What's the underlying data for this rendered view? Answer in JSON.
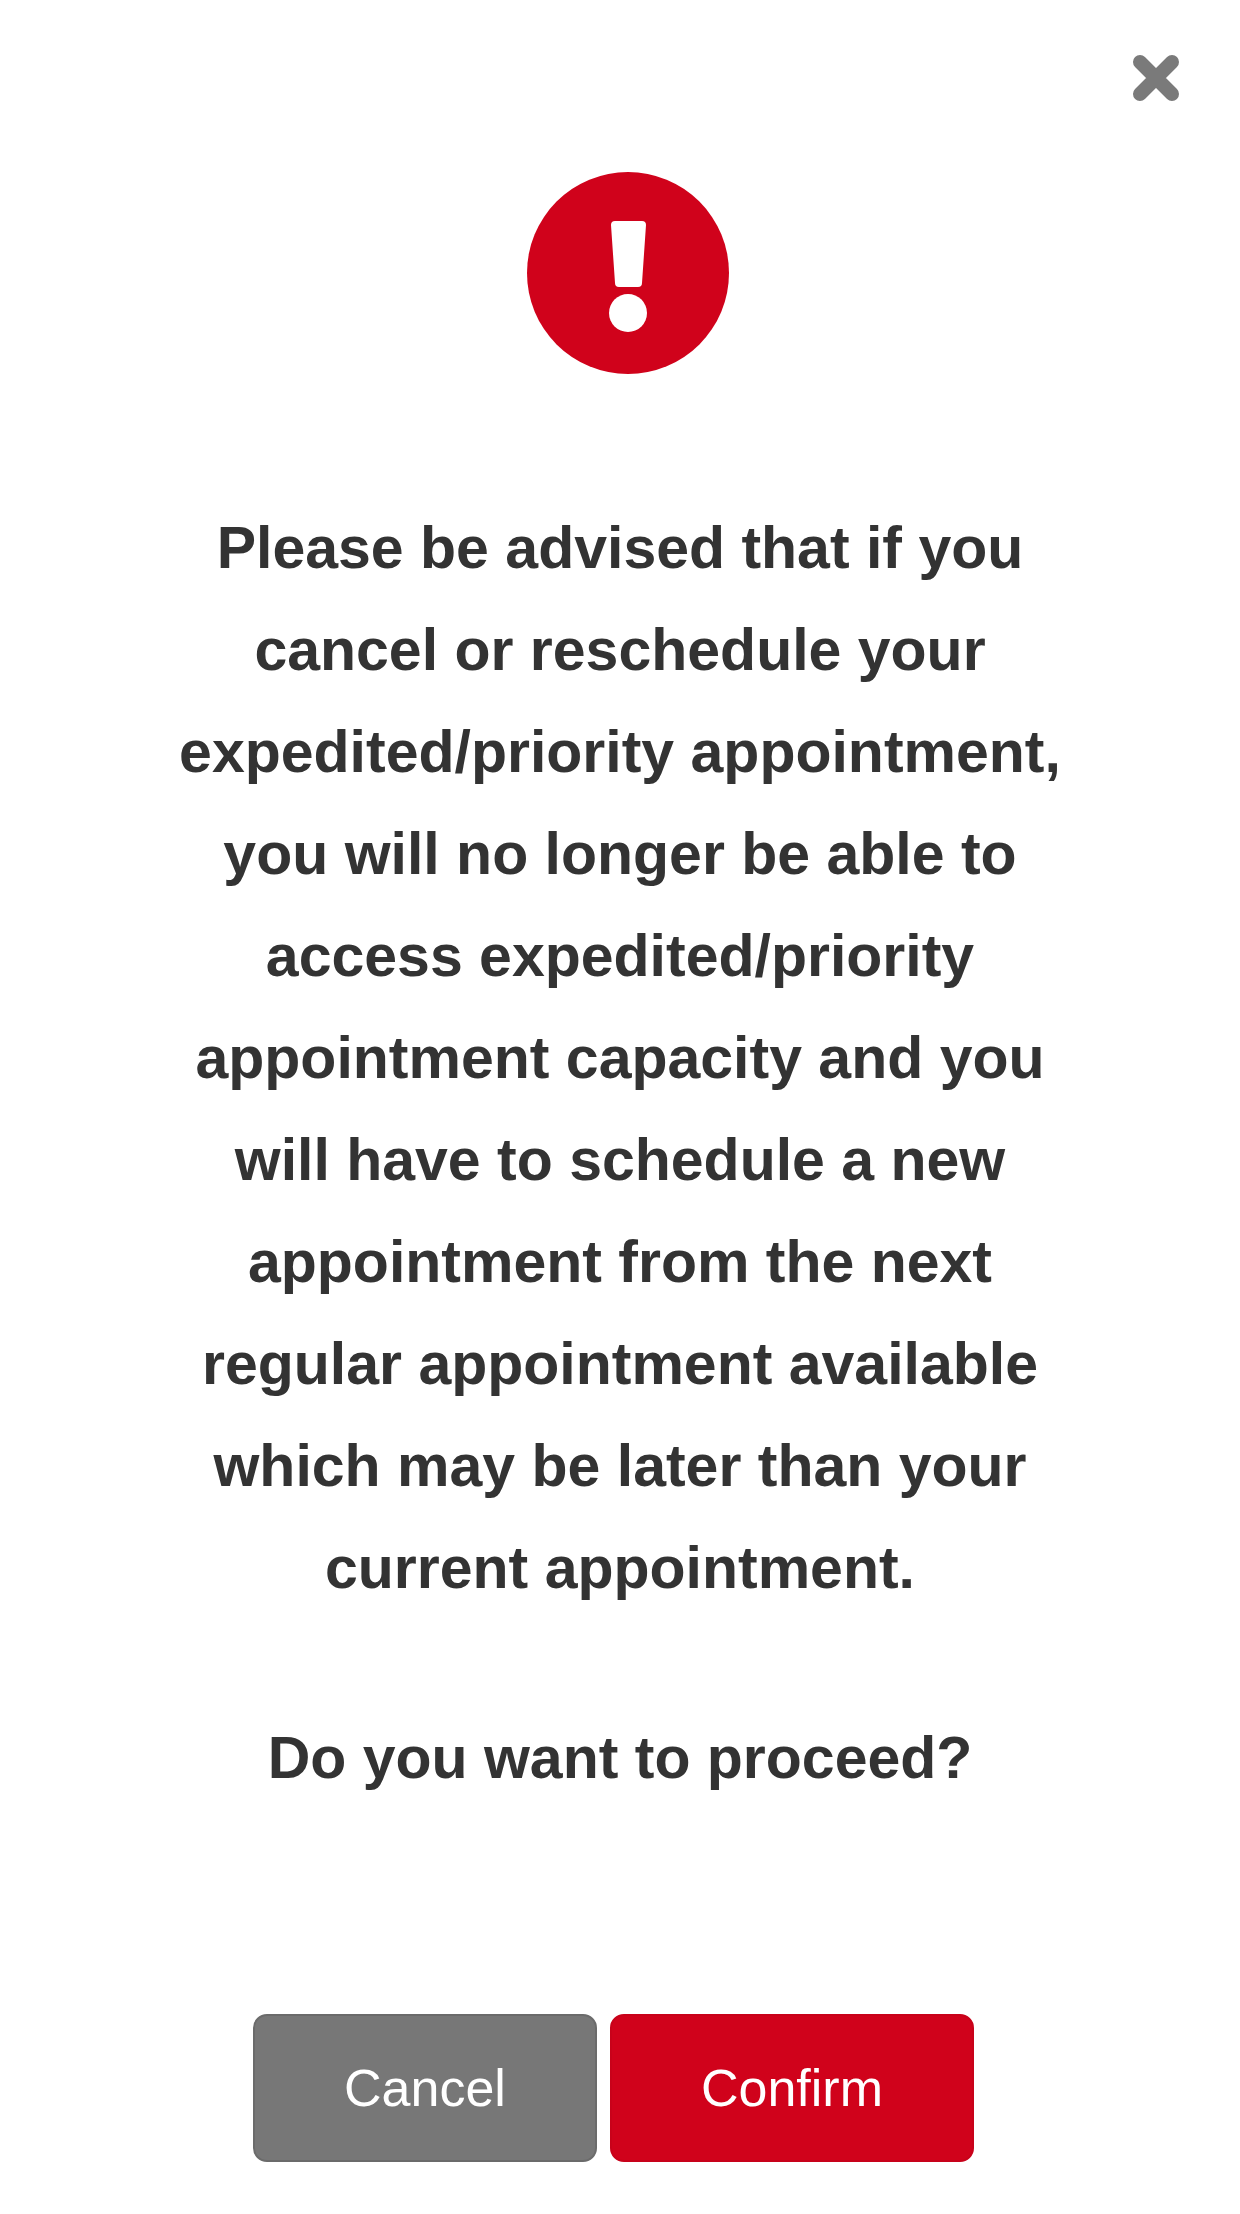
{
  "dialog": {
    "closable": true,
    "icon": {
      "kind": "error"
    },
    "message": "Please be advised that if you cancel or reschedule your expedited/priority appointment, you will no longer be able to access expedited/priority appointment capacity and you will have to schedule a new appointment from the next regular appointment available which may be later than your current appointment.",
    "question": "Do you want to proceed?",
    "buttons": [
      {
        "label": "Cancel",
        "kind": "secondary"
      },
      {
        "label": "Confirm",
        "kind": "primary"
      }
    ]
  }
}
